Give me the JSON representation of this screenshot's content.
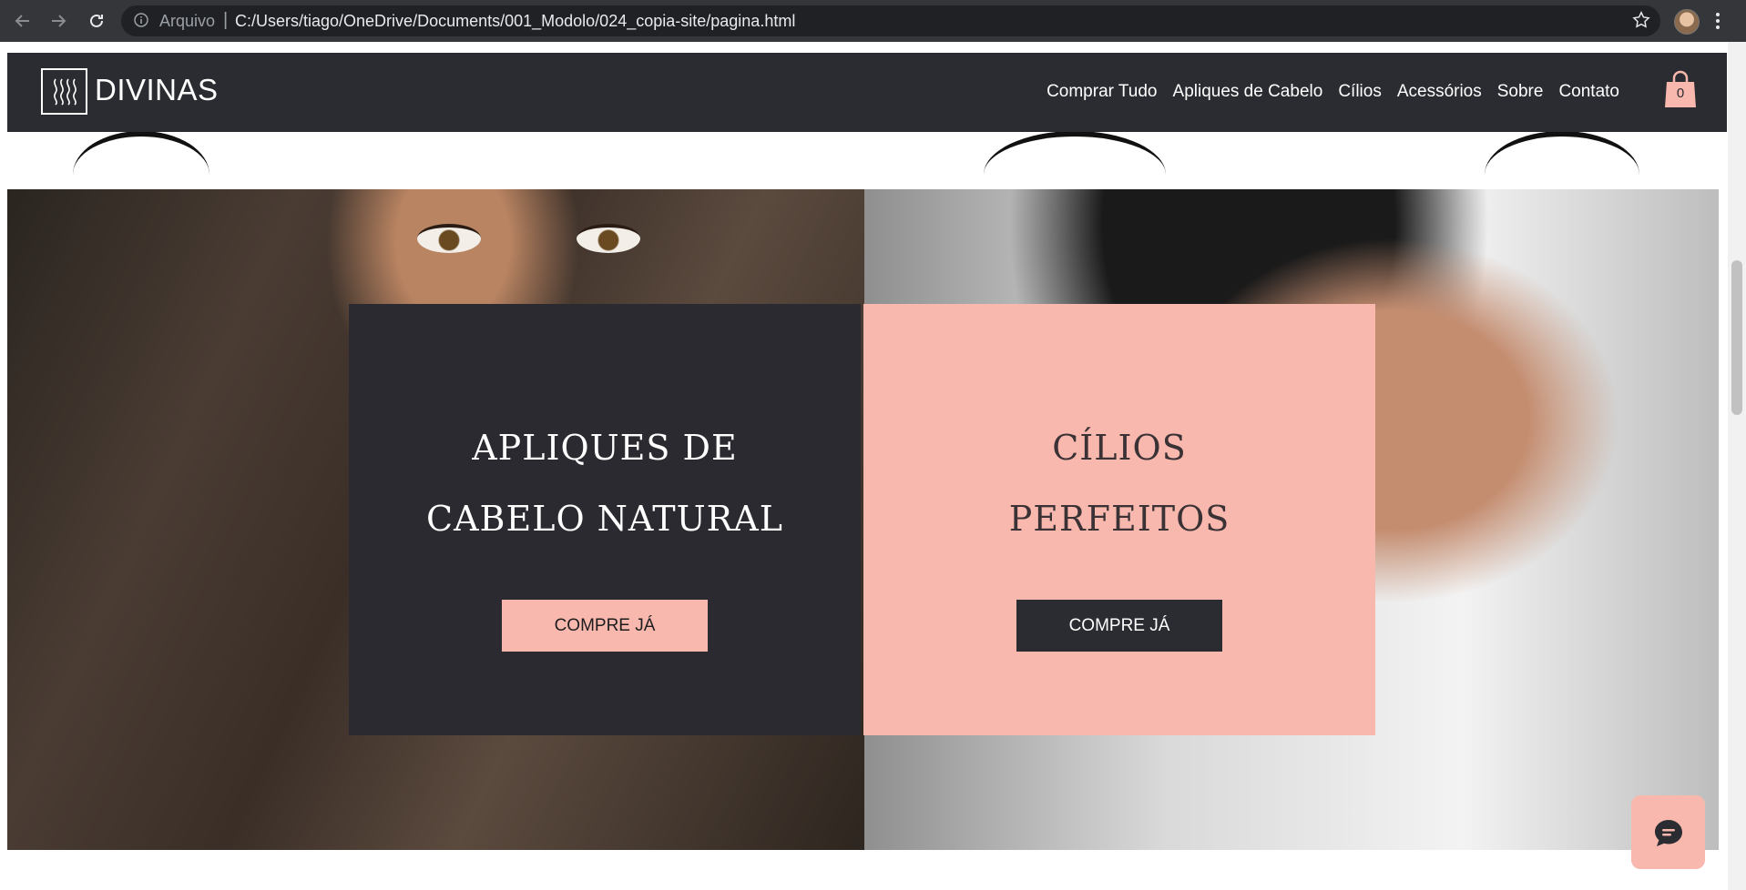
{
  "browser": {
    "scheme_label": "Arquivo",
    "url": "C:/Users/tiago/OneDrive/Documents/001_Modolo/024_copia-site/pagina.html"
  },
  "site": {
    "logo_text": "DIVINAS",
    "menu": [
      {
        "label": "Comprar Tudo"
      },
      {
        "label": "Apliques de Cabelo"
      },
      {
        "label": "Cílios"
      },
      {
        "label": "Acessórios"
      },
      {
        "label": "Sobre"
      },
      {
        "label": "Contato"
      }
    ],
    "cart_count": "0"
  },
  "hero": {
    "left": {
      "title_line1": "APLIQUES DE",
      "title_line2": "CABELO NATURAL",
      "button": "COMPRE JÁ"
    },
    "right": {
      "title_line1": "CÍLIOS",
      "title_line2": "PERFEITOS",
      "button": "COMPRE JÁ"
    }
  },
  "colors": {
    "header_bg": "#2b2c31",
    "accent_pink": "#f9b8ae",
    "panel_dark": "#2b2a30"
  },
  "icons": [
    "back-arrow-icon",
    "forward-arrow-icon",
    "reload-icon",
    "info-icon",
    "star-icon",
    "kebab-menu-icon",
    "hair-logo-icon",
    "shopping-bag-icon",
    "chat-icon"
  ]
}
